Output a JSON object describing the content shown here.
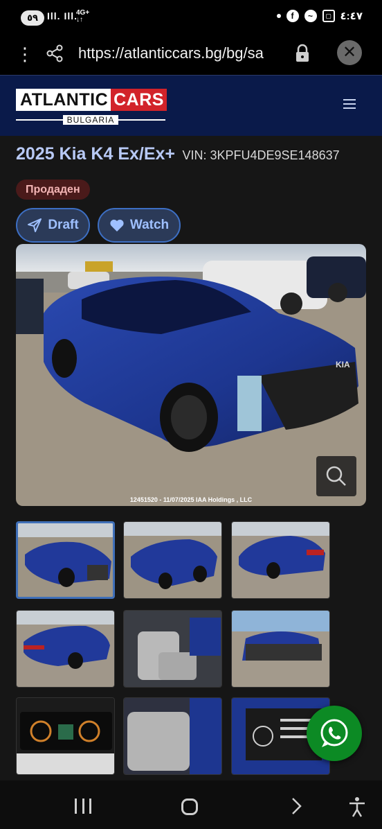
{
  "status_bar": {
    "battery": "٥٩",
    "signal": "Ill. Ill.",
    "network_top": "4G+",
    "network_bottom": "↓↑",
    "time": "٤:٤٧",
    "icons": [
      "dot",
      "facebook-icon",
      "messenger-icon",
      "screenshot-icon"
    ]
  },
  "browser": {
    "url": "https://atlanticcars.bg/bg/sa",
    "menu_icon": "more-vert-icon",
    "share_icon": "share-icon",
    "lock_icon": "lock-icon",
    "close_icon": "close-icon"
  },
  "site": {
    "logo_word1": "ATLANTIC",
    "logo_word2": "CARS",
    "logo_sub": "BULGARIA",
    "brand_red": "#d2232a",
    "header_bg": "#0a1a4a",
    "menu_icon": "hamburger-icon"
  },
  "listing": {
    "title": "2025 Kia K4 Ex/Ex+",
    "vin": "VIN: 3KPFU4DE9SE148637",
    "status": "Продаден",
    "draft_label": "Draft",
    "watch_label": "Watch",
    "photo_caption": "12451520 - 11/07/2025 IAA Holdings , LLC",
    "accent": "#3d6fc4"
  },
  "gallery": {
    "thumbnails": [
      "front-right damaged car",
      "front damaged car",
      "rear left car",
      "rear left car 2",
      "interior front seats",
      "front bumper damage",
      "instrument cluster",
      "rear seats",
      "manufacturer label"
    ],
    "active_index": 0
  },
  "nav": {
    "recents_icon": "recents-icon",
    "home_icon": "home-icon",
    "back_icon": "back-icon",
    "accessibility_icon": "accessibility-icon"
  }
}
